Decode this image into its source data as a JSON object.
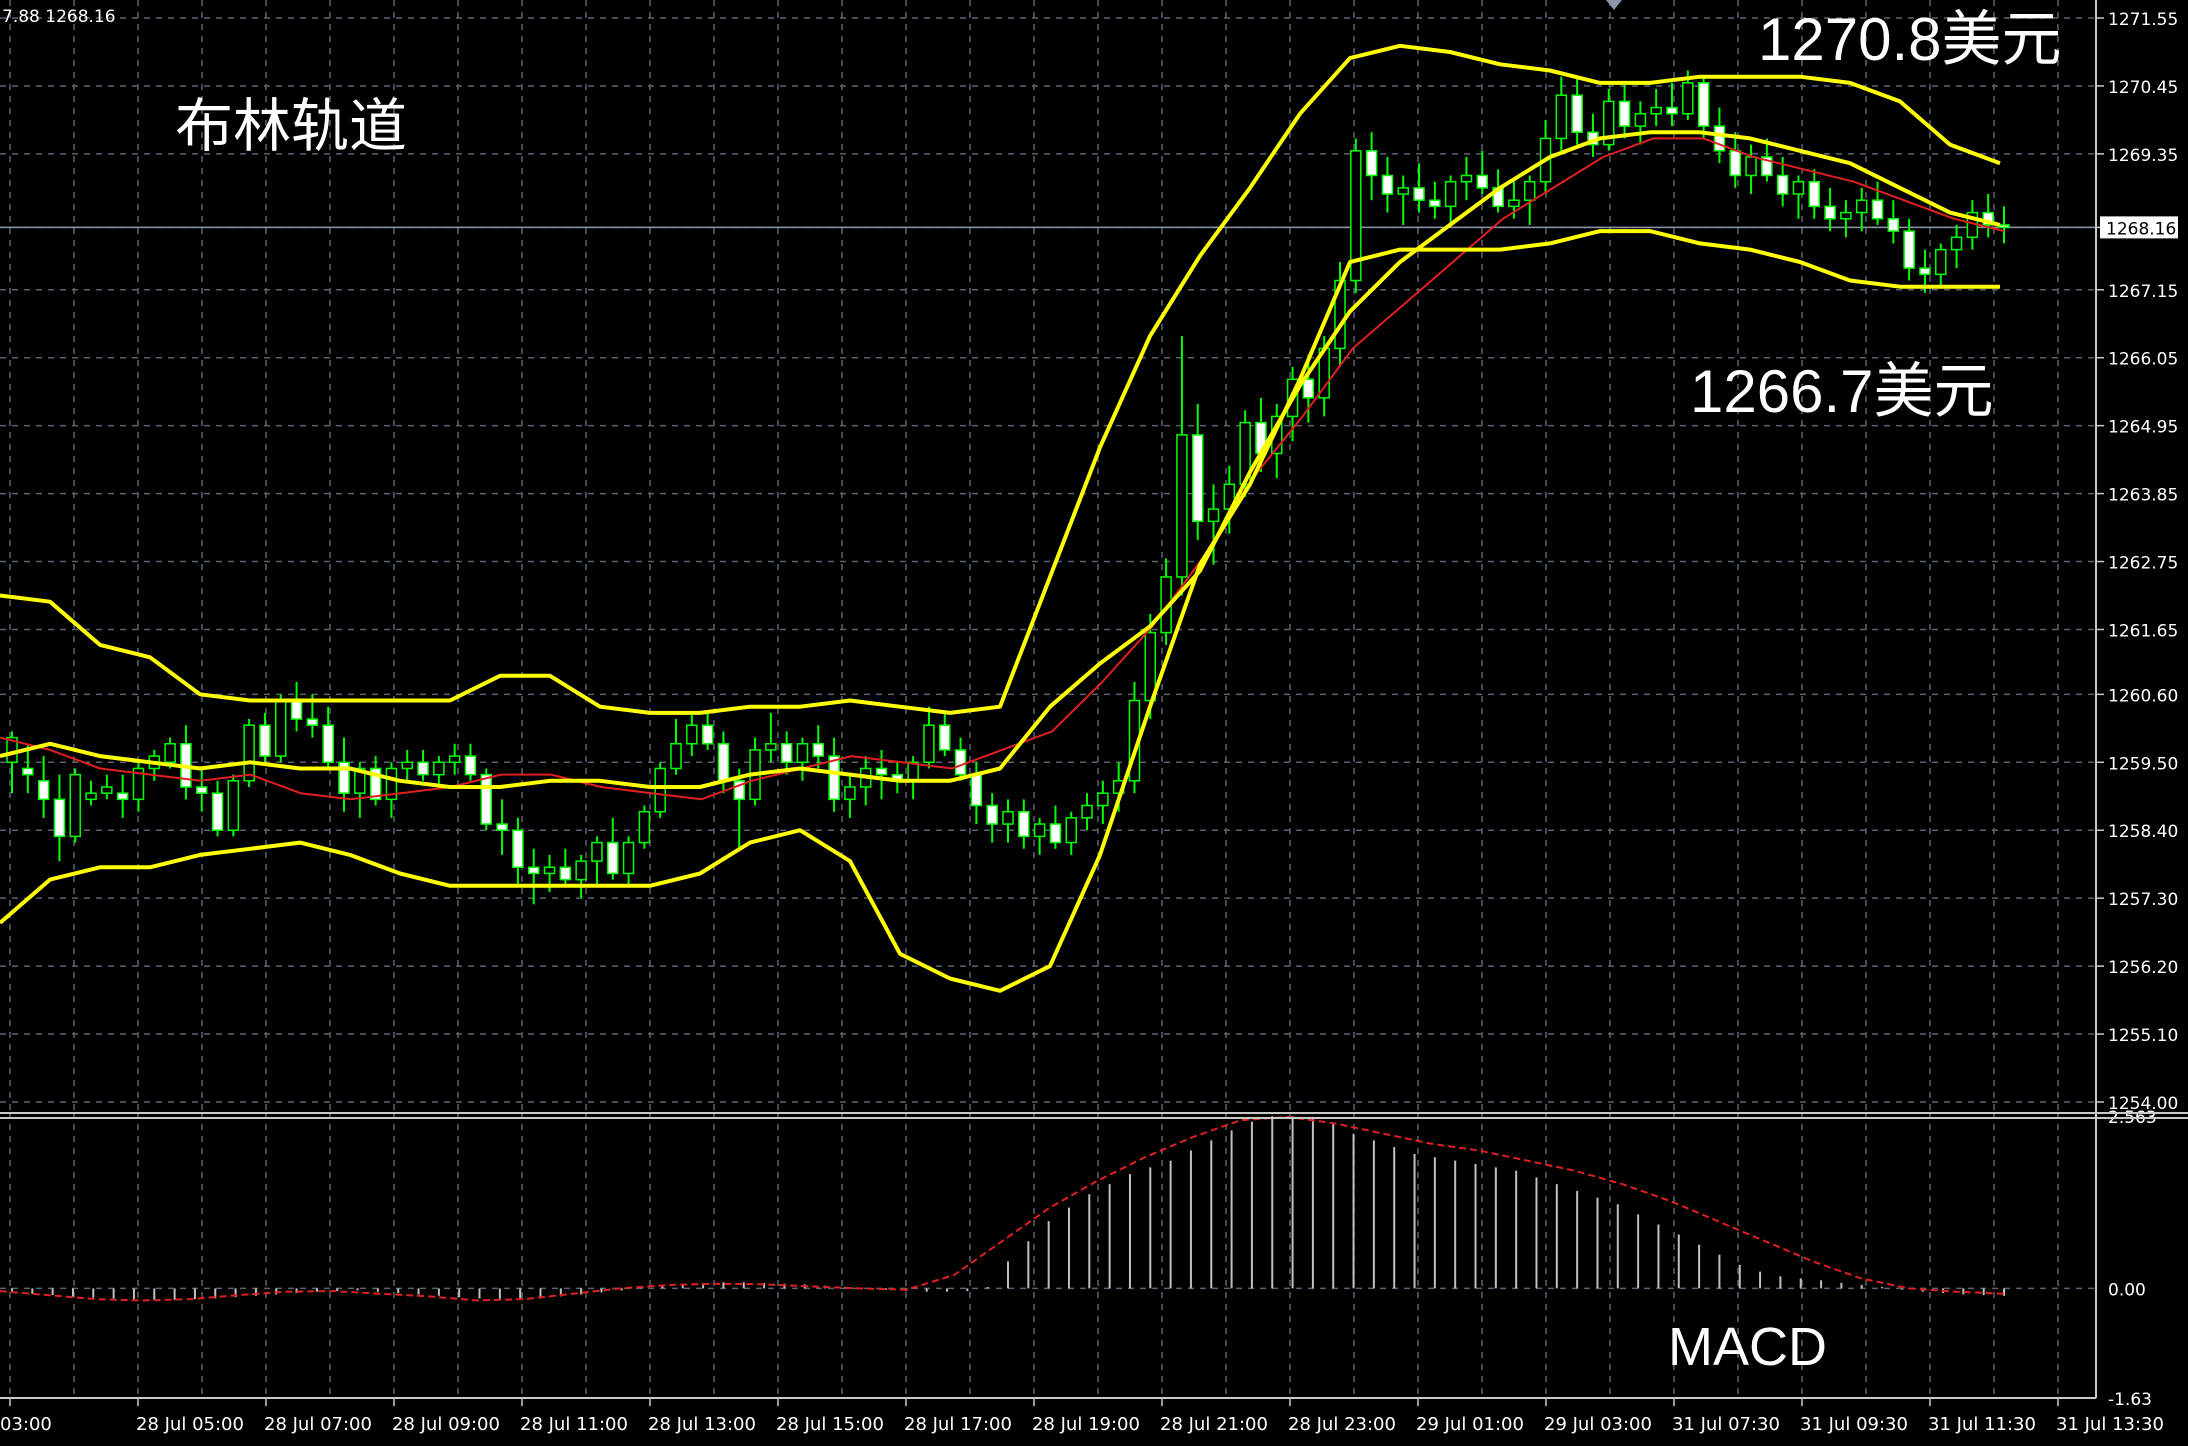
{
  "header": {
    "ohlc_readout": "7.88 1268.16"
  },
  "annotations": {
    "title": "布林轨道",
    "upper_band_label": "1270.8美元",
    "lower_band_label": "1266.7美元",
    "macd_label": "MACD"
  },
  "colors": {
    "background": "#000000",
    "grid": "#5a6470",
    "frame": "#c8c8c8",
    "bollinger": "#ffff00",
    "ma": "#e02020",
    "candle_up_body": "#000000",
    "candle_down_body": "#ffffff",
    "candle_wick": "#00ff00",
    "macd_hist": "#c0c0c0",
    "macd_signal": "#e02020",
    "text": "#ffffff"
  },
  "chart_data": {
    "type": "candlestick",
    "symbol_timeframe": "H? (price chart with Bollinger Bands and MACD)",
    "price_axis": {
      "ylim": [
        1254.0,
        1271.55
      ],
      "ticks": [
        "1271.55",
        "1270.45",
        "1269.35",
        "1268.16",
        "1267.15",
        "1266.05",
        "1264.95",
        "1263.85",
        "1262.75",
        "1261.65",
        "1260.60",
        "1259.50",
        "1258.40",
        "1257.30",
        "1256.20",
        "1255.10",
        "1254.00"
      ],
      "current_price": "1268.16"
    },
    "macd_axis": {
      "ylim": [
        -1.63,
        2.563
      ],
      "ticks": [
        "2.563",
        "0.00",
        "-1.63"
      ]
    },
    "time_axis": {
      "ticks": [
        "03:00",
        "28 Jul 05:00",
        "28 Jul 07:00",
        "28 Jul 09:00",
        "28 Jul 11:00",
        "28 Jul 13:00",
        "28 Jul 15:00",
        "28 Jul 17:00",
        "28 Jul 19:00",
        "28 Jul 21:00",
        "28 Jul 23:00",
        "29 Jul 01:00",
        "29 Jul 03:00",
        "31 Jul 07:30",
        "31 Jul 09:30",
        "31 Jul 11:30",
        "31 Jul 13:30"
      ]
    },
    "candles": [
      [
        1259.5,
        1260.0,
        1259.0,
        1259.9
      ],
      [
        1259.4,
        1259.8,
        1259.0,
        1259.3
      ],
      [
        1259.2,
        1259.6,
        1258.6,
        1258.9
      ],
      [
        1258.9,
        1259.3,
        1257.9,
        1258.3
      ],
      [
        1258.3,
        1259.4,
        1258.2,
        1259.3
      ],
      [
        1258.9,
        1259.2,
        1258.8,
        1259.0
      ],
      [
        1259.0,
        1259.3,
        1258.9,
        1259.1
      ],
      [
        1259.0,
        1259.3,
        1258.6,
        1258.9
      ],
      [
        1258.9,
        1259.5,
        1258.7,
        1259.4
      ],
      [
        1259.4,
        1259.7,
        1259.2,
        1259.6
      ],
      [
        1259.5,
        1259.9,
        1259.4,
        1259.8
      ],
      [
        1259.8,
        1260.1,
        1258.9,
        1259.1
      ],
      [
        1259.1,
        1259.4,
        1258.7,
        1259.0
      ],
      [
        1259.0,
        1259.2,
        1258.3,
        1258.4
      ],
      [
        1258.4,
        1259.3,
        1258.3,
        1259.2
      ],
      [
        1259.2,
        1260.2,
        1259.1,
        1260.1
      ],
      [
        1260.1,
        1260.3,
        1259.5,
        1259.6
      ],
      [
        1259.6,
        1260.6,
        1259.5,
        1260.5
      ],
      [
        1260.5,
        1260.8,
        1260.0,
        1260.2
      ],
      [
        1260.2,
        1260.6,
        1259.9,
        1260.1
      ],
      [
        1260.1,
        1260.4,
        1259.4,
        1259.5
      ],
      [
        1259.5,
        1259.9,
        1258.7,
        1259.0
      ],
      [
        1259.0,
        1259.5,
        1258.6,
        1259.4
      ],
      [
        1259.4,
        1259.6,
        1258.8,
        1258.9
      ],
      [
        1258.9,
        1259.5,
        1258.6,
        1259.4
      ],
      [
        1259.4,
        1259.7,
        1259.2,
        1259.5
      ],
      [
        1259.5,
        1259.7,
        1259.2,
        1259.3
      ],
      [
        1259.3,
        1259.6,
        1259.1,
        1259.5
      ],
      [
        1259.5,
        1259.8,
        1259.3,
        1259.6
      ],
      [
        1259.6,
        1259.8,
        1259.2,
        1259.3
      ],
      [
        1259.3,
        1259.4,
        1258.4,
        1258.5
      ],
      [
        1258.5,
        1258.9,
        1258.0,
        1258.4
      ],
      [
        1258.4,
        1258.6,
        1257.5,
        1257.8
      ],
      [
        1257.8,
        1258.1,
        1257.2,
        1257.7
      ],
      [
        1257.7,
        1258.0,
        1257.4,
        1257.8
      ],
      [
        1257.8,
        1258.1,
        1257.5,
        1257.6
      ],
      [
        1257.6,
        1258.0,
        1257.3,
        1257.9
      ],
      [
        1257.9,
        1258.3,
        1257.5,
        1258.2
      ],
      [
        1258.2,
        1258.6,
        1257.6,
        1257.7
      ],
      [
        1257.7,
        1258.3,
        1257.5,
        1258.2
      ],
      [
        1258.2,
        1258.8,
        1258.1,
        1258.7
      ],
      [
        1258.7,
        1259.5,
        1258.6,
        1259.4
      ],
      [
        1259.4,
        1260.2,
        1259.3,
        1259.8
      ],
      [
        1259.8,
        1260.3,
        1259.6,
        1260.1
      ],
      [
        1260.1,
        1260.3,
        1259.7,
        1259.8
      ],
      [
        1259.8,
        1260.0,
        1259.0,
        1259.2
      ],
      [
        1259.2,
        1259.4,
        1258.1,
        1258.9
      ],
      [
        1258.9,
        1259.9,
        1258.8,
        1259.7
      ],
      [
        1259.7,
        1260.3,
        1259.5,
        1259.8
      ],
      [
        1259.8,
        1260.0,
        1259.3,
        1259.5
      ],
      [
        1259.5,
        1259.9,
        1259.2,
        1259.8
      ],
      [
        1259.8,
        1260.1,
        1259.4,
        1259.6
      ],
      [
        1259.6,
        1259.9,
        1258.7,
        1258.9
      ],
      [
        1258.9,
        1259.3,
        1258.6,
        1259.1
      ],
      [
        1259.1,
        1259.6,
        1258.8,
        1259.4
      ],
      [
        1259.4,
        1259.7,
        1258.9,
        1259.3
      ],
      [
        1259.3,
        1259.5,
        1259.0,
        1259.2
      ],
      [
        1259.2,
        1259.6,
        1258.9,
        1259.5
      ],
      [
        1259.5,
        1260.4,
        1259.4,
        1260.1
      ],
      [
        1260.1,
        1260.3,
        1259.6,
        1259.7
      ],
      [
        1259.7,
        1259.9,
        1259.2,
        1259.3
      ],
      [
        1259.3,
        1259.5,
        1258.5,
        1258.8
      ],
      [
        1258.8,
        1259.0,
        1258.2,
        1258.5
      ],
      [
        1258.5,
        1258.9,
        1258.2,
        1258.7
      ],
      [
        1258.7,
        1258.9,
        1258.1,
        1258.3
      ],
      [
        1258.3,
        1258.6,
        1258.0,
        1258.5
      ],
      [
        1258.5,
        1258.8,
        1258.1,
        1258.2
      ],
      [
        1258.2,
        1258.7,
        1258.0,
        1258.6
      ],
      [
        1258.6,
        1259.0,
        1258.4,
        1258.8
      ],
      [
        1258.8,
        1259.2,
        1258.5,
        1259.0
      ],
      [
        1259.0,
        1259.5,
        1258.7,
        1259.2
      ],
      [
        1259.2,
        1260.8,
        1259.0,
        1260.5
      ],
      [
        1260.5,
        1261.9,
        1260.2,
        1261.6
      ],
      [
        1261.6,
        1262.8,
        1261.4,
        1262.5
      ],
      [
        1262.5,
        1266.4,
        1262.2,
        1264.8
      ],
      [
        1264.8,
        1265.3,
        1263.1,
        1263.4
      ],
      [
        1263.4,
        1264.0,
        1262.7,
        1263.6
      ],
      [
        1263.6,
        1264.3,
        1263.2,
        1264.0
      ],
      [
        1264.0,
        1265.2,
        1263.8,
        1265.0
      ],
      [
        1265.0,
        1265.4,
        1264.2,
        1264.5
      ],
      [
        1264.5,
        1265.3,
        1264.1,
        1265.1
      ],
      [
        1265.1,
        1265.9,
        1264.7,
        1265.7
      ],
      [
        1265.7,
        1266.1,
        1265.0,
        1265.4
      ],
      [
        1265.4,
        1266.4,
        1265.1,
        1266.2
      ],
      [
        1266.2,
        1267.6,
        1265.9,
        1267.3
      ],
      [
        1267.3,
        1269.6,
        1267.1,
        1269.4
      ],
      [
        1269.4,
        1269.7,
        1268.6,
        1269.0
      ],
      [
        1269.0,
        1269.3,
        1268.4,
        1268.7
      ],
      [
        1268.7,
        1269.0,
        1268.2,
        1268.8
      ],
      [
        1268.8,
        1269.2,
        1268.4,
        1268.6
      ],
      [
        1268.6,
        1268.9,
        1268.3,
        1268.5
      ],
      [
        1268.5,
        1269.0,
        1268.2,
        1268.9
      ],
      [
        1268.9,
        1269.3,
        1268.6,
        1269.0
      ],
      [
        1269.0,
        1269.4,
        1268.7,
        1268.8
      ],
      [
        1268.8,
        1269.1,
        1268.4,
        1268.5
      ],
      [
        1268.5,
        1268.9,
        1268.3,
        1268.6
      ],
      [
        1268.6,
        1269.0,
        1268.2,
        1268.9
      ],
      [
        1268.9,
        1269.9,
        1268.7,
        1269.6
      ],
      [
        1269.6,
        1270.6,
        1269.4,
        1270.3
      ],
      [
        1270.3,
        1270.6,
        1269.5,
        1269.7
      ],
      [
        1269.7,
        1270.0,
        1269.3,
        1269.5
      ],
      [
        1269.5,
        1270.4,
        1269.4,
        1270.2
      ],
      [
        1270.2,
        1270.5,
        1269.6,
        1269.8
      ],
      [
        1269.8,
        1270.2,
        1269.5,
        1270.0
      ],
      [
        1270.0,
        1270.4,
        1269.8,
        1270.1
      ],
      [
        1270.1,
        1270.5,
        1269.8,
        1270.0
      ],
      [
        1270.0,
        1270.7,
        1269.9,
        1270.5
      ],
      [
        1270.5,
        1270.6,
        1269.6,
        1269.8
      ],
      [
        1269.8,
        1270.1,
        1269.2,
        1269.4
      ],
      [
        1269.4,
        1269.7,
        1268.8,
        1269.0
      ],
      [
        1269.0,
        1269.5,
        1268.7,
        1269.3
      ],
      [
        1269.3,
        1269.6,
        1268.9,
        1269.0
      ],
      [
        1269.0,
        1269.3,
        1268.5,
        1268.7
      ],
      [
        1268.7,
        1269.0,
        1268.3,
        1268.9
      ],
      [
        1268.9,
        1269.1,
        1268.3,
        1268.5
      ],
      [
        1268.5,
        1268.8,
        1268.1,
        1268.3
      ],
      [
        1268.3,
        1268.6,
        1268.0,
        1268.4
      ],
      [
        1268.4,
        1268.8,
        1268.1,
        1268.6
      ],
      [
        1268.6,
        1268.9,
        1268.2,
        1268.3
      ],
      [
        1268.3,
        1268.6,
        1267.9,
        1268.1
      ],
      [
        1268.1,
        1268.3,
        1267.3,
        1267.5
      ],
      [
        1267.5,
        1267.8,
        1267.1,
        1267.4
      ],
      [
        1267.4,
        1267.9,
        1267.2,
        1267.8
      ],
      [
        1267.8,
        1268.2,
        1267.5,
        1268.0
      ],
      [
        1268.0,
        1268.6,
        1267.8,
        1268.4
      ],
      [
        1268.4,
        1268.7,
        1268.0,
        1268.2
      ],
      [
        1268.2,
        1268.5,
        1267.9,
        1268.16
      ]
    ],
    "bollinger": {
      "upper": [
        1262.2,
        1262.1,
        1261.4,
        1261.2,
        1260.6,
        1260.5,
        1260.5,
        1260.5,
        1260.5,
        1260.5,
        1260.9,
        1260.9,
        1260.4,
        1260.3,
        1260.3,
        1260.4,
        1260.4,
        1260.5,
        1260.4,
        1260.3,
        1260.4,
        1262.5,
        1264.6,
        1266.4,
        1267.7,
        1268.8,
        1270.0,
        1270.9,
        1271.1,
        1271.0,
        1270.8,
        1270.7,
        1270.5,
        1270.5,
        1270.6,
        1270.6,
        1270.6,
        1270.5,
        1270.2,
        1269.5,
        1269.2
      ],
      "middle": [
        1259.6,
        1259.8,
        1259.6,
        1259.5,
        1259.4,
        1259.5,
        1259.4,
        1259.4,
        1259.2,
        1259.1,
        1259.1,
        1259.2,
        1259.2,
        1259.1,
        1259.1,
        1259.3,
        1259.4,
        1259.3,
        1259.2,
        1259.2,
        1259.4,
        1260.4,
        1261.1,
        1261.7,
        1262.6,
        1264.2,
        1265.6,
        1266.8,
        1267.6,
        1268.2,
        1268.8,
        1269.3,
        1269.6,
        1269.7,
        1269.7,
        1269.6,
        1269.4,
        1269.2,
        1268.8,
        1268.4,
        1268.2
      ],
      "lower": [
        1256.9,
        1257.6,
        1257.8,
        1257.8,
        1258.0,
        1258.1,
        1258.2,
        1258.0,
        1257.7,
        1257.5,
        1257.5,
        1257.5,
        1257.5,
        1257.5,
        1257.7,
        1258.2,
        1258.4,
        1257.9,
        1256.4,
        1256.0,
        1255.8,
        1256.2,
        1258.0,
        1260.4,
        1262.7,
        1264.0,
        1265.7,
        1267.6,
        1267.8,
        1267.8,
        1267.8,
        1267.9,
        1268.1,
        1268.1,
        1267.9,
        1267.8,
        1267.6,
        1267.3,
        1267.2,
        1267.2,
        1267.2
      ]
    },
    "moving_average": [
      1259.9,
      1259.7,
      1259.4,
      1259.3,
      1259.2,
      1259.3,
      1259.0,
      1258.9,
      1259.0,
      1259.1,
      1259.3,
      1259.3,
      1259.1,
      1259.0,
      1258.9,
      1259.2,
      1259.4,
      1259.6,
      1259.5,
      1259.4,
      1259.7,
      1260.0,
      1260.8,
      1261.7,
      1262.8,
      1264.1,
      1265.1,
      1266.2,
      1266.9,
      1267.6,
      1268.3,
      1268.8,
      1269.3,
      1269.6,
      1269.6,
      1269.3,
      1269.1,
      1268.9,
      1268.6,
      1268.3,
      1268.1
    ],
    "macd_histogram": [
      -0.05,
      -0.08,
      -0.1,
      -0.12,
      -0.14,
      -0.15,
      -0.16,
      -0.17,
      -0.17,
      -0.16,
      -0.15,
      -0.13,
      -0.11,
      -0.09,
      -0.07,
      -0.05,
      -0.04,
      -0.03,
      -0.05,
      -0.07,
      -0.09,
      -0.11,
      -0.13,
      -0.15,
      -0.16,
      -0.17,
      -0.15,
      -0.12,
      -0.09,
      -0.06,
      -0.03,
      0.02,
      0.05,
      0.07,
      0.08,
      0.09,
      0.09,
      0.08,
      0.07,
      0.06,
      0.04,
      0.02,
      0.0,
      -0.02,
      -0.04,
      -0.05,
      -0.05,
      -0.04,
      0.02,
      0.4,
      0.7,
      1.0,
      1.2,
      1.4,
      1.55,
      1.7,
      1.8,
      1.9,
      2.05,
      2.2,
      2.35,
      2.48,
      2.56,
      2.56,
      2.55,
      2.45,
      2.3,
      2.2,
      2.1,
      2.0,
      1.95,
      1.9,
      1.85,
      1.8,
      1.75,
      1.65,
      1.55,
      1.45,
      1.35,
      1.25,
      1.1,
      0.95,
      0.8,
      0.65,
      0.5,
      0.35,
      0.25,
      0.18,
      0.15,
      0.12,
      0.08,
      0.05,
      0.02,
      -0.02,
      -0.05,
      -0.07,
      -0.09,
      -0.1,
      -0.11
    ],
    "macd_signal": [
      -0.04,
      -0.1,
      -0.16,
      -0.18,
      -0.16,
      -0.1,
      -0.05,
      -0.04,
      -0.08,
      -0.12,
      -0.18,
      -0.16,
      -0.08,
      0.0,
      0.05,
      0.07,
      0.06,
      0.03,
      0.0,
      -0.02,
      0.2,
      0.7,
      1.2,
      1.6,
      1.95,
      2.25,
      2.5,
      2.55,
      2.45,
      2.3,
      2.15,
      2.05,
      1.9,
      1.75,
      1.55,
      1.3,
      1.0,
      0.7,
      0.4,
      0.15,
      0.0,
      -0.05,
      -0.08
    ]
  }
}
